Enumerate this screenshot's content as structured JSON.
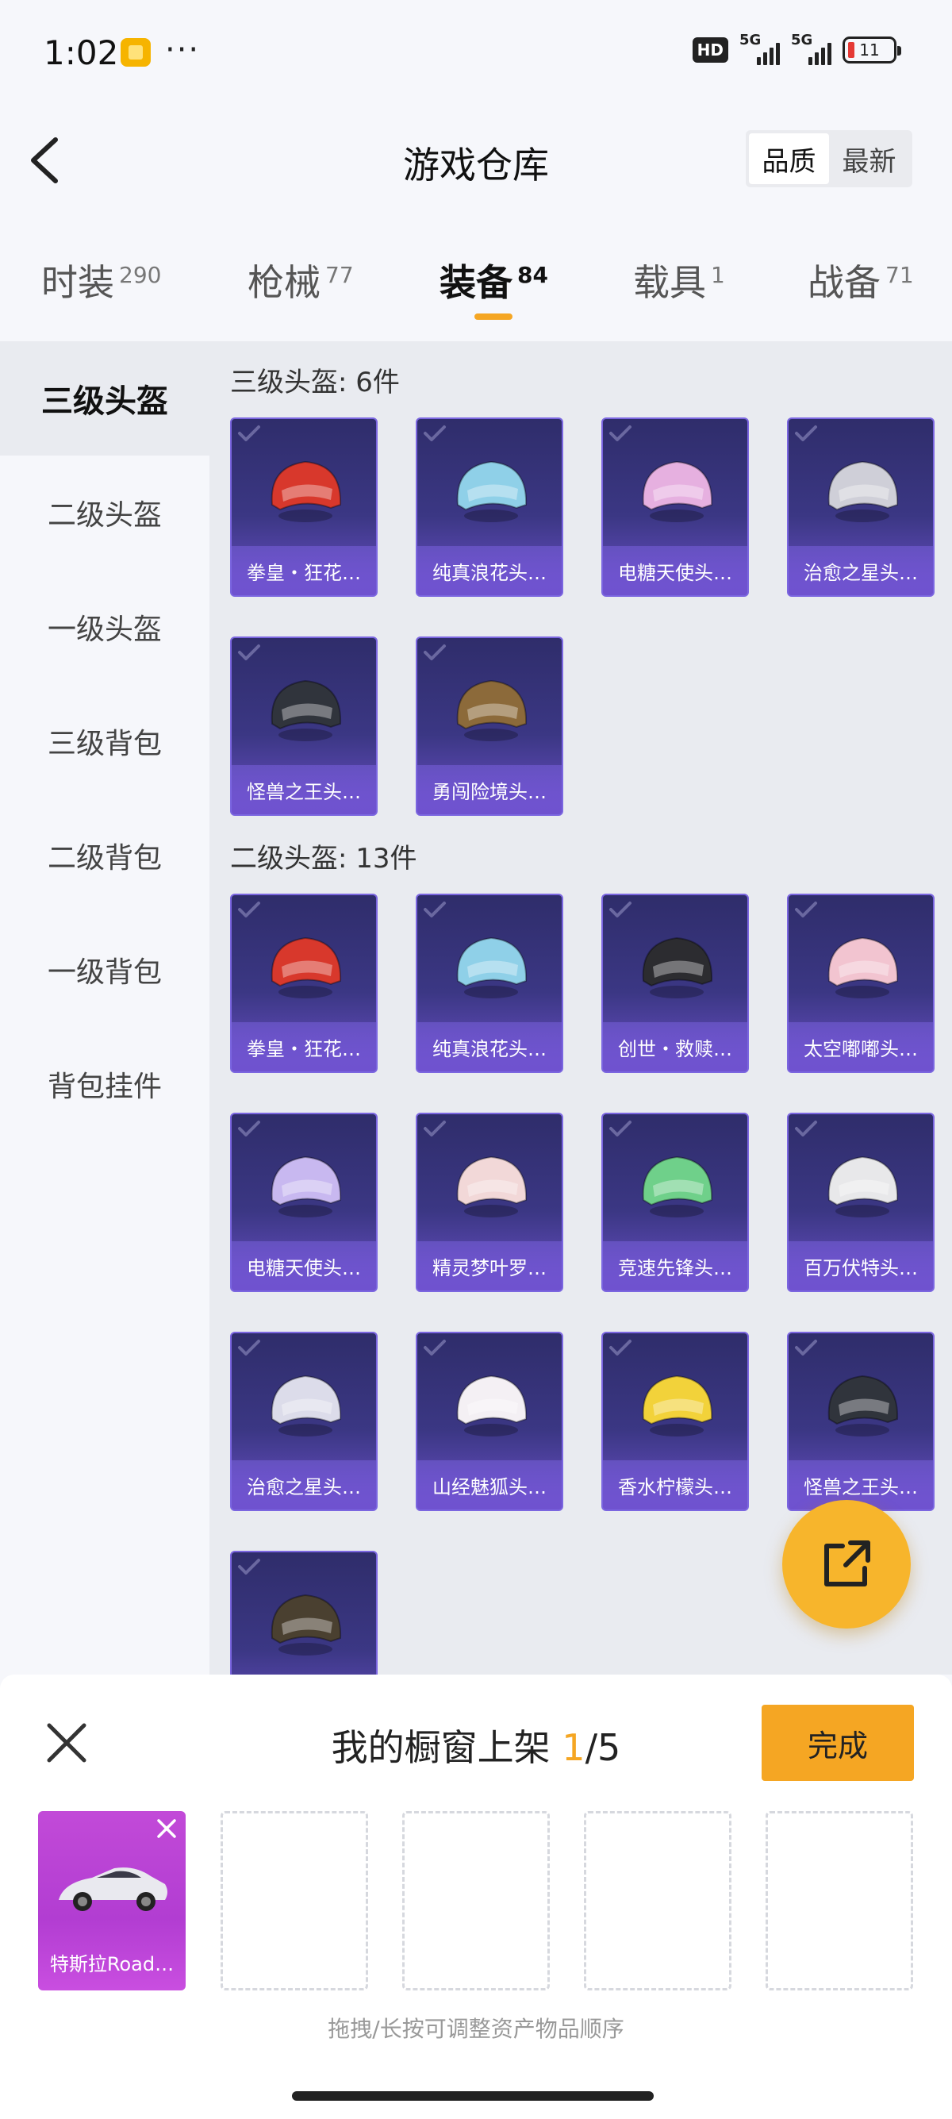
{
  "status": {
    "time": "1:02",
    "dots": "···",
    "hd": "HD",
    "net1": "5G",
    "net2": "5G",
    "battery": "11"
  },
  "header": {
    "title": "游戏仓库",
    "sort_quality": "品质",
    "sort_newest": "最新"
  },
  "tabs": [
    {
      "label": "时装",
      "count": "290"
    },
    {
      "label": "枪械",
      "count": "77"
    },
    {
      "label": "装备",
      "count": "84"
    },
    {
      "label": "载具",
      "count": "1"
    },
    {
      "label": "战备",
      "count": "71"
    }
  ],
  "sidebar": [
    "三级头盔",
    "二级头盔",
    "一级头盔",
    "三级背包",
    "二级背包",
    "一级背包",
    "背包挂件"
  ],
  "sections": [
    {
      "title": "三级头盔: 6件",
      "items": [
        "拳皇・狂花…",
        "纯真浪花头…",
        "电糖天使头…",
        "治愈之星头…",
        "怪兽之王头…",
        "勇闯险境头…"
      ]
    },
    {
      "title": "二级头盔: 13件",
      "items": [
        "拳皇・狂花…",
        "纯真浪花头…",
        "创世・救赎…",
        "太空嘟嘟头…",
        "电糖天使头…",
        "精灵梦叶罗…",
        "竞速先锋头…",
        "百万伏特头…",
        "治愈之星头…",
        "山经魅狐头…",
        "香水柠檬头…",
        "怪兽之王头…",
        ""
      ]
    }
  ],
  "showcase": {
    "title_prefix": "我的橱窗上架 ",
    "current": "1",
    "total": "/5",
    "done_label": "完成",
    "slot1_name": "特斯拉Road…",
    "hint": "拖拽/长按可调整资产物品顺序"
  },
  "colors": {
    "accent": "#f5a623",
    "card": "#3b3784",
    "showcase_card": "#b23dd2"
  }
}
